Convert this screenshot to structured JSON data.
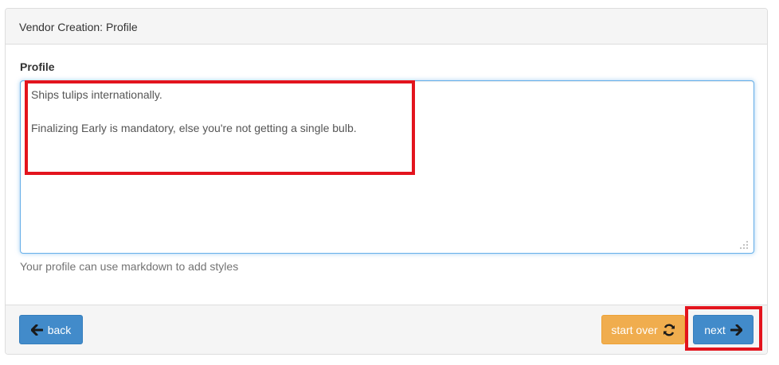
{
  "panel": {
    "title": "Vendor Creation: Profile"
  },
  "profile": {
    "label": "Profile",
    "lines": [
      "Ships tulips internationally.",
      "",
      "Finalizing Early is mandatory, else you're not getting a single bulb."
    ],
    "help": "Your profile can use markdown to add styles"
  },
  "footer": {
    "back_label": "back",
    "start_over_label": "start over",
    "next_label": "next"
  },
  "icons": {
    "back": "arrow-left-icon",
    "start_over": "refresh-icon",
    "next": "arrow-right-icon"
  },
  "colors": {
    "primary": "#428bca",
    "warning": "#f0ad4e",
    "highlight": "#e3141d",
    "focus_border": "#66afe9"
  }
}
